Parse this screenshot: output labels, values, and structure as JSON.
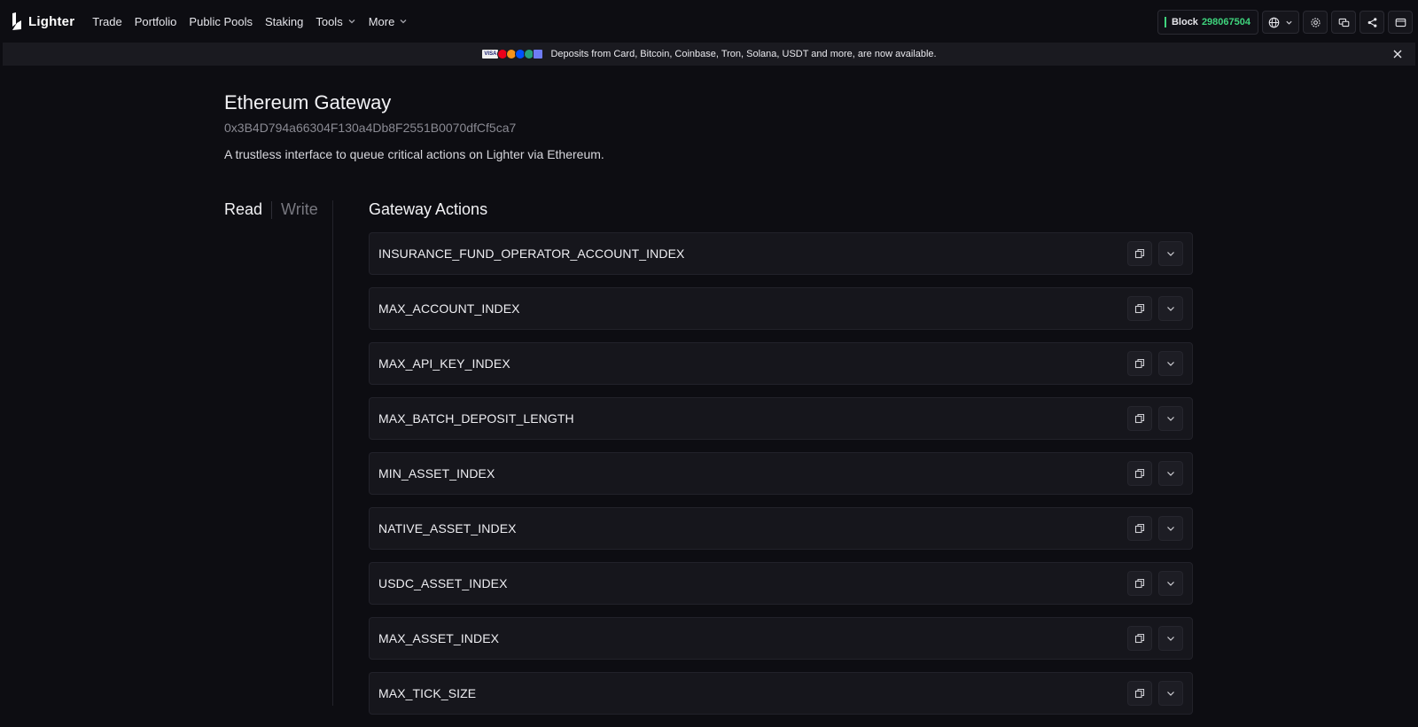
{
  "app": {
    "name": "Lighter"
  },
  "nav": {
    "items": [
      {
        "label": "Trade",
        "dropdown": false
      },
      {
        "label": "Portfolio",
        "dropdown": false
      },
      {
        "label": "Public Pools",
        "dropdown": false
      },
      {
        "label": "Staking",
        "dropdown": false
      },
      {
        "label": "Tools",
        "dropdown": true
      },
      {
        "label": "More",
        "dropdown": true
      }
    ]
  },
  "status": {
    "block_label": "Block",
    "block_number": "298067504",
    "accent": "#3fd47d"
  },
  "toolbar": {
    "icons": [
      "globe-icon",
      "settings-icon",
      "chat-icon",
      "share-icon",
      "wallet-icon"
    ]
  },
  "banner": {
    "text": "Deposits from Card, Bitcoin, Coinbase, Tron, Solana, USDT and more, are now available.",
    "payment_icons": [
      "visa-icon",
      "mastercard-icon",
      "bitcoin-icon",
      "coinbase-icon",
      "tether-icon",
      "solana-icon"
    ]
  },
  "page": {
    "title": "Ethereum Gateway",
    "address": "0x3B4D794a66304F130a4Db8F2551B0070dfCf5ca7",
    "description": "A trustless interface to queue critical actions on Lighter via Ethereum."
  },
  "tabs": {
    "read": "Read",
    "write": "Write",
    "active": "read"
  },
  "section": {
    "title": "Gateway Actions"
  },
  "actions": [
    "INSURANCE_FUND_OPERATOR_ACCOUNT_INDEX",
    "MAX_ACCOUNT_INDEX",
    "MAX_API_KEY_INDEX",
    "MAX_BATCH_DEPOSIT_LENGTH",
    "MIN_ASSET_INDEX",
    "NATIVE_ASSET_INDEX",
    "USDC_ASSET_INDEX",
    "MAX_ASSET_INDEX",
    "MAX_TICK_SIZE"
  ]
}
